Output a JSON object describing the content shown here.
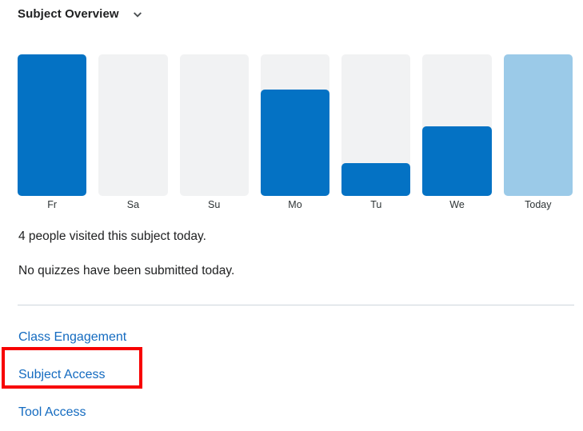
{
  "header": {
    "title": "Subject Overview",
    "collapse_icon": "chevron-down-icon"
  },
  "chart_data": {
    "type": "bar",
    "title": "Subject Overview",
    "xlabel": "",
    "ylabel": "",
    "ylim": [
      0,
      100
    ],
    "grid": false,
    "legend": "none",
    "categories": [
      "Fr",
      "Sa",
      "Su",
      "Mo",
      "Tu",
      "We",
      "Today"
    ],
    "values": [
      100,
      0,
      0,
      75,
      23,
      49,
      100
    ],
    "track_max": 100,
    "colors": {
      "bar": "#0472c4",
      "today_bar": "#9bcae8",
      "track": "#f1f2f3"
    },
    "bars": [
      {
        "label": "Fr",
        "value": 100,
        "today": false
      },
      {
        "label": "Sa",
        "value": 0,
        "today": false
      },
      {
        "label": "Su",
        "value": 0,
        "today": false
      },
      {
        "label": "Mo",
        "value": 75,
        "today": false
      },
      {
        "label": "Tu",
        "value": 23,
        "today": false
      },
      {
        "label": "We",
        "value": 49,
        "today": false
      },
      {
        "label": "Today",
        "value": 100,
        "today": true
      }
    ]
  },
  "summary": {
    "visits_text": "4 people visited this subject today.",
    "quizzes_text": "No quizzes have been submitted today."
  },
  "links": [
    {
      "label": "Class Engagement",
      "name": "link-class-engagement",
      "highlighted": false
    },
    {
      "label": "Subject Access",
      "name": "link-subject-access",
      "highlighted": true
    },
    {
      "label": "Tool Access",
      "name": "link-tool-access",
      "highlighted": false
    }
  ],
  "annotation": {
    "color": "#f70000",
    "target": "Subject Access"
  }
}
